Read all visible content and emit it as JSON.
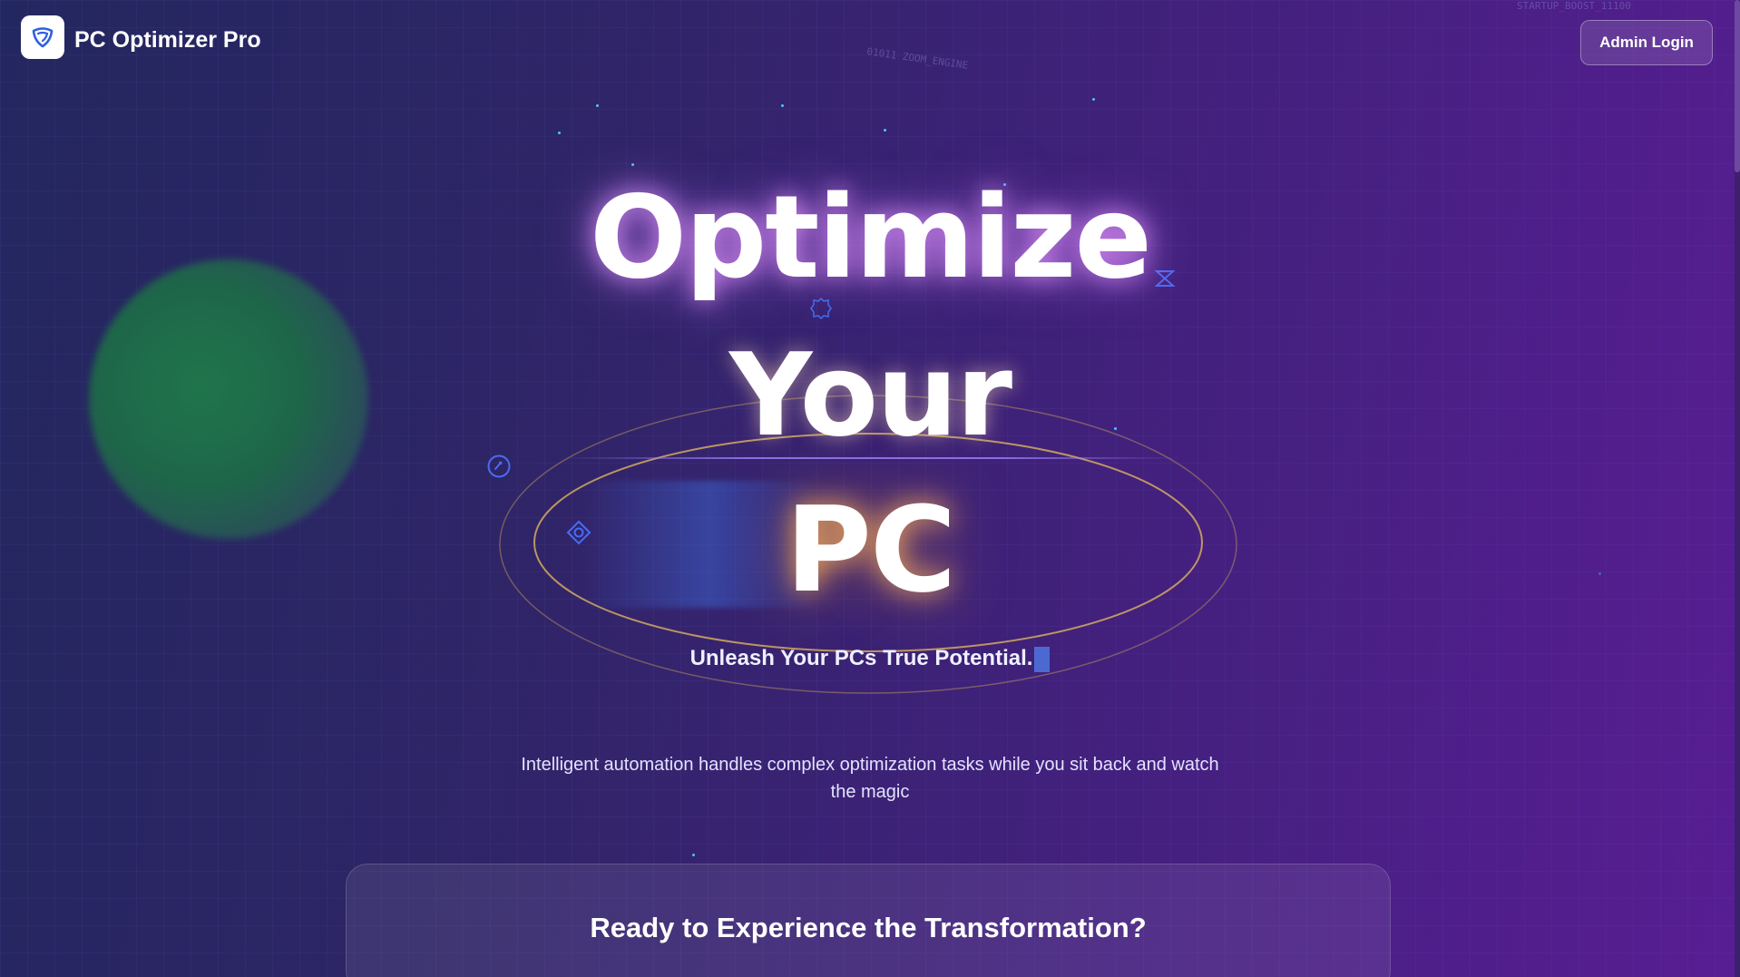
{
  "header": {
    "brand": "PC Optimizer Pro",
    "logo_icon": "shield-icon",
    "admin_button": "Admin Login"
  },
  "hero": {
    "line1": "Optimize",
    "line2": "Your",
    "line3": "PC",
    "tagline": "Unleash Your PCs True Potential.",
    "description": "Intelligent automation handles complex optimization tasks while you sit back and watch the magic"
  },
  "cta_card": {
    "title": "Ready to Experience the Transformation?"
  },
  "background_code": {
    "top_center": "01011 ZOOM_ENGINE",
    "top_right": "STARTUP_BOOST_11100"
  },
  "colors": {
    "bg_left": "#23275f",
    "bg_right": "#581d93",
    "orbit_gold": "#c8a25a",
    "accent_cyan": "#49c6ff",
    "accent_blue": "#4a6cf0"
  },
  "icons": {
    "decorations": [
      "settings-icon",
      "gear-icon",
      "gauge-icon",
      "target-icon",
      "hourglass-icon"
    ]
  }
}
